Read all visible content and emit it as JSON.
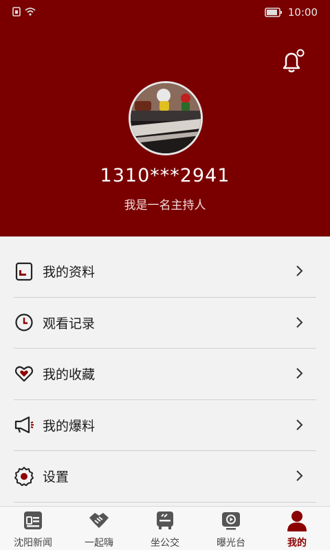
{
  "status_bar": {
    "time": "10:00"
  },
  "profile": {
    "phone": "1310***2941",
    "intro": "我是一名主持人"
  },
  "menu": [
    {
      "label": "我的资料",
      "icon": "profile-card-icon"
    },
    {
      "label": "观看记录",
      "icon": "clock-icon"
    },
    {
      "label": "我的收藏",
      "icon": "heart-icon"
    },
    {
      "label": "我的爆料",
      "icon": "megaphone-icon"
    },
    {
      "label": "设置",
      "icon": "gear-icon"
    }
  ],
  "tabs": [
    {
      "label": "沈阳新闻",
      "icon": "news-icon",
      "active": false
    },
    {
      "label": "一起嗨",
      "icon": "handshake-icon",
      "active": false
    },
    {
      "label": "坐公交",
      "icon": "bus-icon",
      "active": false
    },
    {
      "label": "曝光台",
      "icon": "play-screen-icon",
      "active": false
    },
    {
      "label": "我的",
      "icon": "person-icon",
      "active": true
    }
  ],
  "colors": {
    "brand": "#7a0000",
    "active_tab": "#8b0000",
    "background": "#f2f2f2"
  }
}
